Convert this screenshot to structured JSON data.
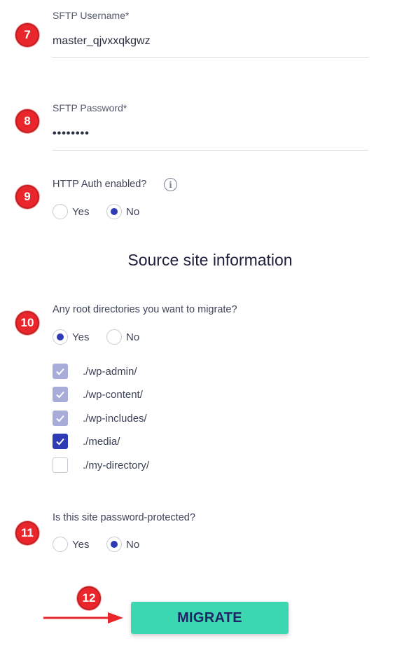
{
  "steps": {
    "s7": "7",
    "s8": "8",
    "s9": "9",
    "s10": "10",
    "s11": "11",
    "s12": "12"
  },
  "sftp_username": {
    "label": "SFTP Username*",
    "value": "master_qjvxxqkgwz"
  },
  "sftp_password": {
    "label": "SFTP Password*",
    "value": "••••••••"
  },
  "http_auth": {
    "question": "HTTP Auth enabled?",
    "info_icon": "info-icon",
    "options": [
      "Yes",
      "No"
    ],
    "selected": "No"
  },
  "section_title": "Source site information",
  "root_dirs": {
    "question": "Any root directories you want to migrate?",
    "options": [
      "Yes",
      "No"
    ],
    "selected": "Yes",
    "directories": [
      {
        "label": "./wp-admin/",
        "state": "checked-disabled"
      },
      {
        "label": "./wp-content/",
        "state": "checked-disabled"
      },
      {
        "label": "./wp-includes/",
        "state": "checked-disabled"
      },
      {
        "label": "./media/",
        "state": "checked"
      },
      {
        "label": "./my-directory/",
        "state": "unchecked"
      }
    ]
  },
  "password_protected": {
    "question": "Is this site password-protected?",
    "options": [
      "Yes",
      "No"
    ],
    "selected": "No"
  },
  "migrate_button": "MIGRATE",
  "colors": {
    "badge_red": "#e8262b",
    "accent_blue": "#2e3bb5",
    "button_teal": "#3ad7b0",
    "arrow_red": "#e8262b"
  }
}
